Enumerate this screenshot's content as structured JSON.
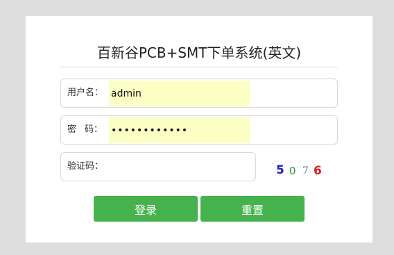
{
  "title": "百新谷PCB+SMT下单系统(英文)",
  "form": {
    "username_label": "用户名：",
    "username_value": "admin",
    "password_label_1": "密",
    "password_label_2": "码：",
    "password_value": "••••••••••••",
    "captcha_label": "验证码：",
    "captcha_value": ""
  },
  "captcha": {
    "digits": [
      "5",
      "0",
      "7",
      "6"
    ],
    "colors": [
      "#1a1ad6",
      "#2a9a2a",
      "#777777",
      "#e01818"
    ]
  },
  "buttons": {
    "login_label": "登录",
    "reset_label": "重置",
    "color": "#46b24e"
  }
}
